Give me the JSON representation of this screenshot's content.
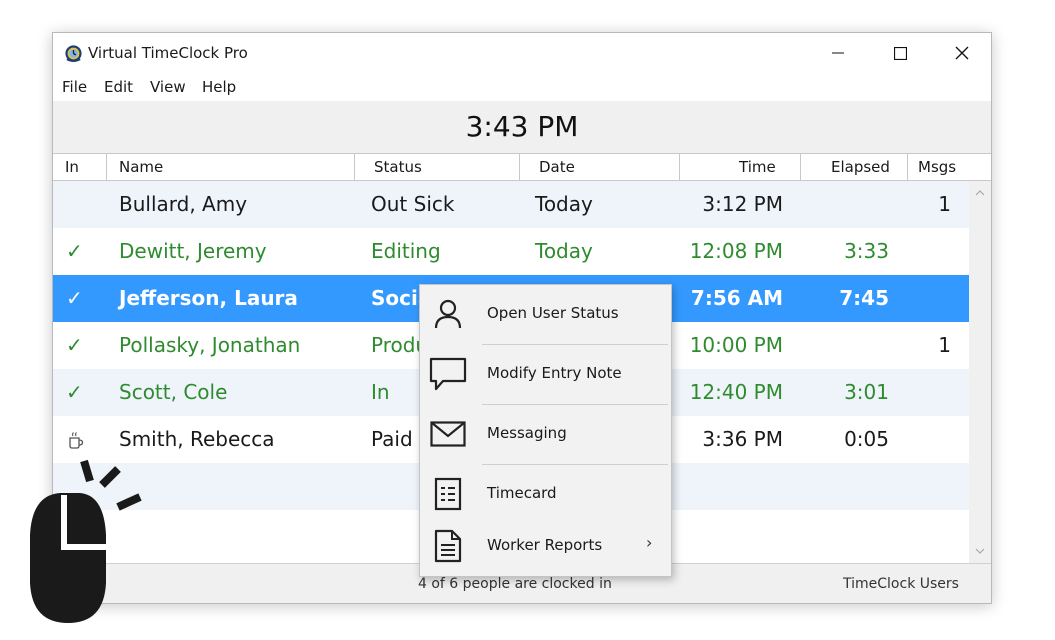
{
  "window": {
    "title": "Virtual TimeClock Pro"
  },
  "menu": [
    "File",
    "Edit",
    "View",
    "Help"
  ],
  "clock": "3:43 PM",
  "columns": {
    "in": "In",
    "name": "Name",
    "status": "Status",
    "date": "Date",
    "time": "Time",
    "elapsed": "Elapsed",
    "msgs": "Msgs"
  },
  "rows": [
    {
      "in": "",
      "name": "Bullard, Amy",
      "status": "Out Sick",
      "date": "Today",
      "time": "3:12 PM",
      "elapsed": "",
      "msgs": "1"
    },
    {
      "in": "✓",
      "name": "Dewitt, Jeremy",
      "status": "Editing",
      "date": "Today",
      "time": "12:08 PM",
      "elapsed": "3:33",
      "msgs": ""
    },
    {
      "in": "✓",
      "name": "Jefferson, Laura",
      "status": "Social",
      "date": "",
      "time": "7:56 AM",
      "elapsed": "7:45",
      "msgs": ""
    },
    {
      "in": "✓",
      "name": "Pollasky, Jonathan",
      "status": "Produ",
      "date": "",
      "time": "10:00 PM",
      "elapsed": "",
      "msgs": "1"
    },
    {
      "in": "✓",
      "name": "Scott, Cole",
      "status": "In",
      "date": "",
      "time": "12:40 PM",
      "elapsed": "3:01",
      "msgs": ""
    },
    {
      "in": "",
      "name": "Smith, Rebecca",
      "status": "Paid I",
      "date": "",
      "time": "3:36 PM",
      "elapsed": "0:05",
      "msgs": ""
    }
  ],
  "status_bar": {
    "summary": "4 of 6 people are clocked in",
    "right": "TimeClock Users"
  },
  "context_menu": [
    {
      "label": "Open User Status",
      "icon": "user-icon"
    },
    {
      "label": "Modify Entry Note",
      "icon": "speech-bubble-icon"
    },
    {
      "label": "Messaging",
      "icon": "envelope-icon"
    },
    {
      "label": "Timecard",
      "icon": "timecard-icon"
    },
    {
      "label": "Worker Reports",
      "icon": "document-icon",
      "submenu": "›"
    }
  ],
  "colors": {
    "selection": "#3399ff",
    "clocked_in_text": "#2e8b2e",
    "alt_row": "#eff4fb"
  }
}
